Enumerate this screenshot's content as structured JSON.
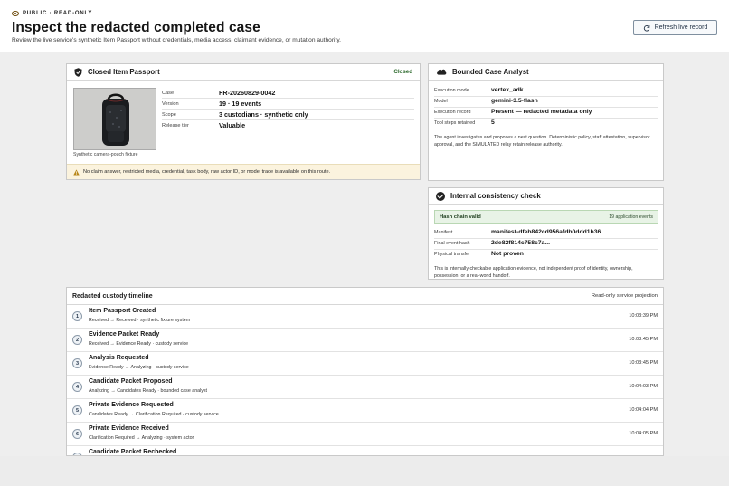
{
  "header": {
    "visibility": "PUBLIC · READ-ONLY",
    "title": "Inspect the redacted completed case",
    "subtitle": "Review the live service's synthetic Item Passport without credentials, media access, claimant evidence, or mutation authority.",
    "refresh_label": "Refresh live record"
  },
  "passport": {
    "title": "Closed Item Passport",
    "status": "Closed",
    "image_caption": "Synthetic camera-pouch fixture",
    "fields": [
      {
        "label": "Case",
        "value": "FR-20260829-0042"
      },
      {
        "label": "Version",
        "value": "19 · 19 events"
      },
      {
        "label": "Scope",
        "value": "3 custodians · synthetic only"
      },
      {
        "label": "Release tier",
        "value": "Valuable"
      }
    ],
    "notice": "No claim answer, restricted media, credential, task body, raw actor ID, or model trace is available on this route."
  },
  "analyst": {
    "title": "Bounded Case Analyst",
    "fields": [
      {
        "label": "Execution mode",
        "value": "vertex_adk"
      },
      {
        "label": "Model",
        "value": "gemini-3.5-flash"
      },
      {
        "label": "Execution record",
        "value": "Present — redacted metadata only"
      },
      {
        "label": "Tool steps retained",
        "value": "5"
      }
    ],
    "description": "The agent investigates and proposes a next question. Deterministic policy, staff attestation, supervisor approval, and the SIMULATED relay retain release authority."
  },
  "consistency": {
    "title": "Internal consistency check",
    "hash_status": "Hash chain valid",
    "event_count": "19 application events",
    "fields": [
      {
        "label": "Manifest",
        "value": "manifest-dfeb842cd956afdb0ddd1b36"
      },
      {
        "label": "Final event hash",
        "value": "2de82f814c758c7a..."
      },
      {
        "label": "Physical transfer",
        "value": "Not proven"
      }
    ],
    "description": "This is internally checkable application evidence, not independent proof of identity, ownership, possession, or a real-world handoff."
  },
  "timeline": {
    "title": "Redacted custody timeline",
    "projection": "Read-only service projection",
    "events": [
      {
        "n": "1",
        "title": "Item Passport Created",
        "detail": "Received → Received · synthetic fixture system",
        "time": "10:03:39 PM"
      },
      {
        "n": "2",
        "title": "Evidence Packet Ready",
        "detail": "Received → Evidence Ready · custody service",
        "time": "10:03:45 PM"
      },
      {
        "n": "3",
        "title": "Analysis Requested",
        "detail": "Evidence Ready → Analyzing · custody service",
        "time": "10:03:45 PM"
      },
      {
        "n": "4",
        "title": "Candidate Packet Proposed",
        "detail": "Analyzing → Candidates Ready · bounded case analyst",
        "time": "10:04:03 PM"
      },
      {
        "n": "5",
        "title": "Private Evidence Requested",
        "detail": "Candidates Ready → Clarification Required · custody service",
        "time": "10:04:04 PM"
      },
      {
        "n": "6",
        "title": "Private Evidence Received",
        "detail": "Clarification Required → Analyzing · system actor",
        "time": "10:04:05 PM"
      },
      {
        "n": "7",
        "title": "Candidate Packet Rechecked",
        "detail": "",
        "time": ""
      }
    ]
  }
}
